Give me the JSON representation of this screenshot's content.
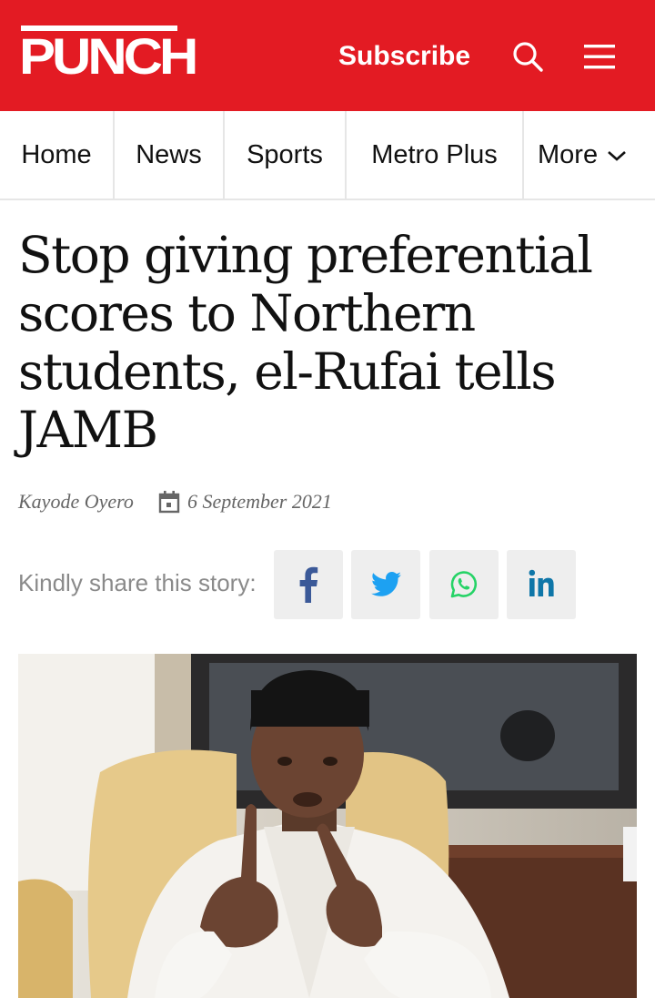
{
  "header": {
    "logo_text": "PUNCH",
    "subscribe_label": "Subscribe",
    "icons": [
      "search-icon",
      "menu-icon"
    ],
    "brand_color": "#e31b23"
  },
  "nav": {
    "items": [
      {
        "label": "Home"
      },
      {
        "label": "News"
      },
      {
        "label": "Sports"
      },
      {
        "label": "Metro Plus"
      },
      {
        "label": "More"
      }
    ]
  },
  "article": {
    "headline": "Stop giving preferential scores to Northern students, el-Rufai tells JAMB",
    "author": "Kayode Oyero",
    "date": "6 September 2021",
    "share_label": "Kindly share this story:",
    "share_buttons": [
      {
        "icon": "facebook-icon",
        "color": "#3b5998"
      },
      {
        "icon": "twitter-icon",
        "color": "#1da1f2"
      },
      {
        "icon": "whatsapp-icon",
        "color": "#25d366"
      },
      {
        "icon": "linkedin-icon",
        "color": "#0e76a8"
      }
    ]
  }
}
